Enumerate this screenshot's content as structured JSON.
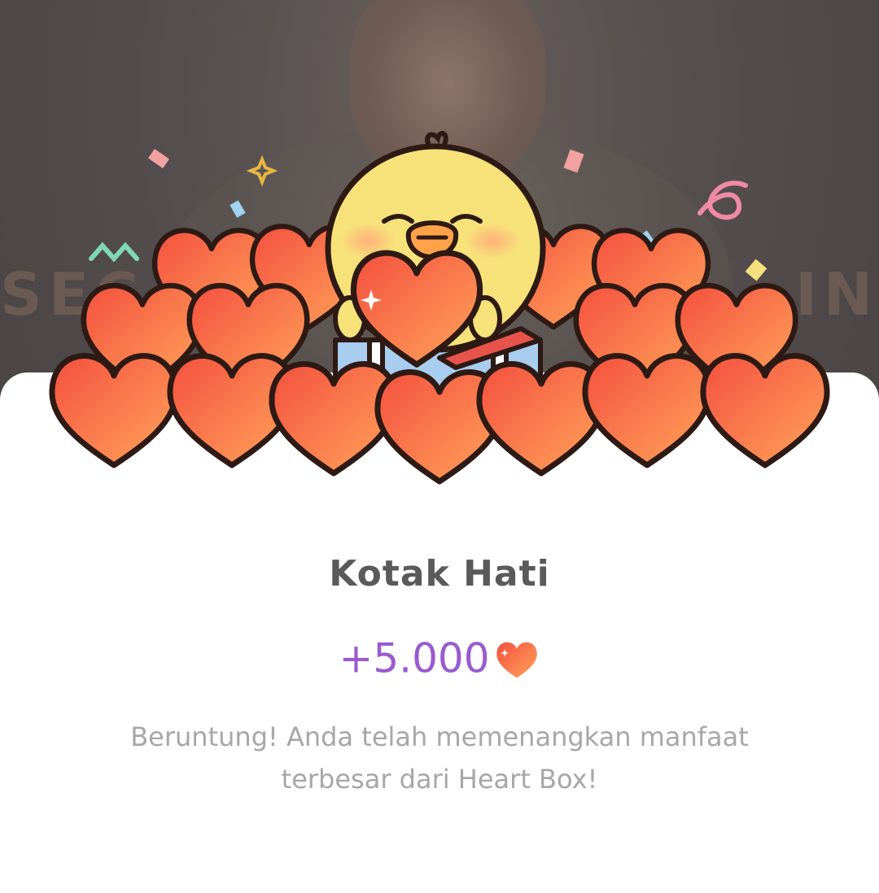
{
  "background": {
    "banner_left": "SEC",
    "banner_right": "IN"
  },
  "dialog": {
    "title": "Kotak Hati",
    "reward_amount": "+5.000",
    "reward_icon": "heart-icon",
    "description": "Beruntung! Anda telah memenangkan manfaat terbesar dari Heart Box!"
  },
  "colors": {
    "accent_purple": "#9a5ad0",
    "heart_red": "#f65a4a",
    "heart_orange": "#ff9b55",
    "chick_yellow": "#f7e27a"
  }
}
